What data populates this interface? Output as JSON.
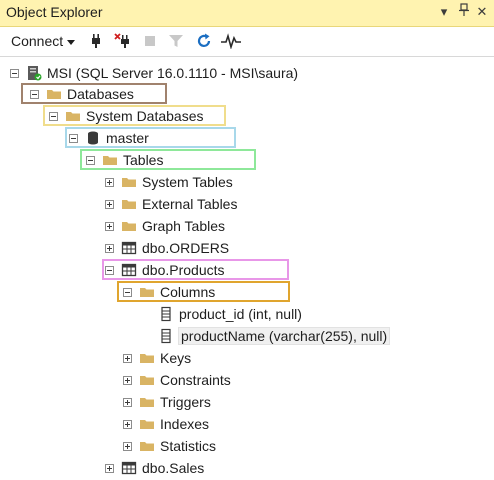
{
  "panel": {
    "title": "Object Explorer",
    "pin_glyph": "▾",
    "pin2_glyph": "⊥",
    "close_glyph": "✕"
  },
  "toolbar": {
    "connect_label": "Connect",
    "icons": [
      "connect-plug-icon",
      "disconnect-icon",
      "stop-icon",
      "filter-icon",
      "refresh-icon",
      "activity-monitor-icon"
    ]
  },
  "tree": {
    "server": "MSI (SQL Server 16.0.1110 - MSI\\saura)",
    "databases": "Databases",
    "system_databases": "System Databases",
    "master": "master",
    "tables": "Tables",
    "system_tables": "System Tables",
    "external_tables": "External Tables",
    "graph_tables": "Graph Tables",
    "dbo_orders": "dbo.ORDERS",
    "dbo_products": "dbo.Products",
    "columns": "Columns",
    "col_product_id": "product_id (int, null)",
    "col_product_name": "productName (varchar(255), null)",
    "keys": "Keys",
    "constraints": "Constraints",
    "triggers": "Triggers",
    "indexes": "Indexes",
    "statistics": "Statistics",
    "dbo_sales": "dbo.Sales"
  },
  "highlight_colors": {
    "databases": "#a0826d",
    "system_databases": "#f0dd8c",
    "master": "#a8d8ea",
    "tables": "#8ee89a",
    "dbo_products": "#e897e8",
    "columns": "#e0a52e"
  },
  "colors": {
    "titlebar_bg": "#fff3b0",
    "folder": "#d9b464",
    "refresh": "#1b6ec2"
  }
}
